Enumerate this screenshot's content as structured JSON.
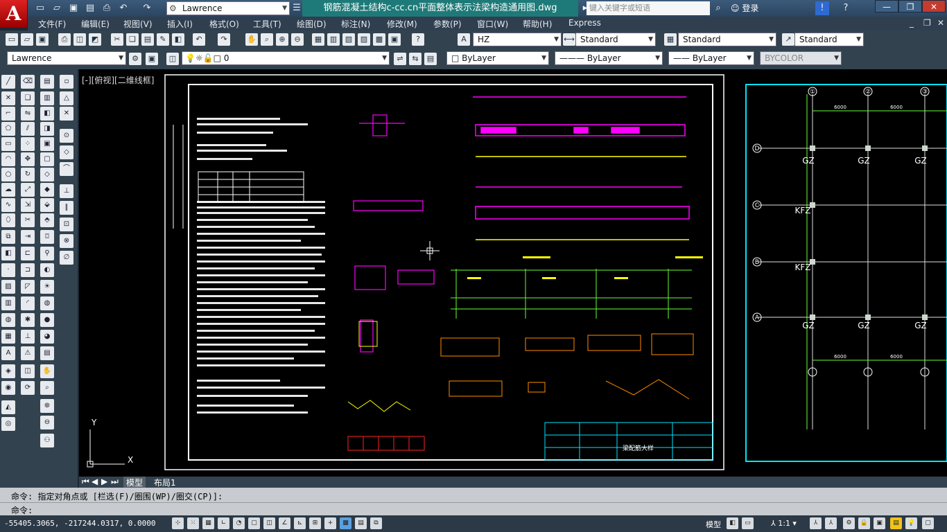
{
  "app": {
    "logo_letter": "A",
    "document_title": "钢筋混凝土结构c-cc.cn平面整体表示法梁构造通用图.dwg",
    "workspace": "Lawrence",
    "search_placeholder": "键入关键字或短语",
    "login_label": "登录"
  },
  "menu": [
    "文件(F)",
    "编辑(E)",
    "视图(V)",
    "插入(I)",
    "格式(O)",
    "工具(T)",
    "绘图(D)",
    "标注(N)",
    "修改(M)",
    "参数(P)",
    "窗口(W)",
    "帮助(H)",
    "Express"
  ],
  "styles": {
    "text_style": "HZ",
    "dim_style": "Standard",
    "table_style": "Standard",
    "mleader_style": "Standard"
  },
  "layers": {
    "workspace_combo": "Lawrence",
    "current_layer": "0",
    "color": "ByLayer",
    "linetype": "ByLayer",
    "lineweight": "ByLayer",
    "plotstyle": "BYCOLOR"
  },
  "viewport": {
    "label": "[-][俯视][二维线框]",
    "ucs_y": "Y",
    "ucs_x": "X"
  },
  "drawing": {
    "title_block_name": "梁配筋大样",
    "grid_labels_x": [
      "①",
      "②",
      "③"
    ],
    "grid_labels_y": [
      "D",
      "C",
      "B",
      "A"
    ],
    "column_labels": [
      "GZ",
      "GZ",
      "GZ",
      "KFZ",
      "KFZ",
      "GZ",
      "GZ",
      "GZ"
    ],
    "dims_top": [
      "6000",
      "6000"
    ],
    "dims_bottom": [
      "6000",
      "6000"
    ]
  },
  "tabs": [
    "模型",
    "布局1"
  ],
  "command": {
    "history": "命令: 指定对角点或 [栏选(F)/圈围(WP)/圈交(CP)]:",
    "prompt": "命令:"
  },
  "status": {
    "coords": "-55405.3065, -217244.0317, 0.0000",
    "space": "模型",
    "scale": "1:1"
  },
  "colors": {
    "background": "#000000",
    "title_teal": "#1e7a78",
    "magenta": "#ff00ff",
    "yellow": "#ffff00",
    "green": "#66ff33",
    "cyan": "#00e5ff"
  }
}
